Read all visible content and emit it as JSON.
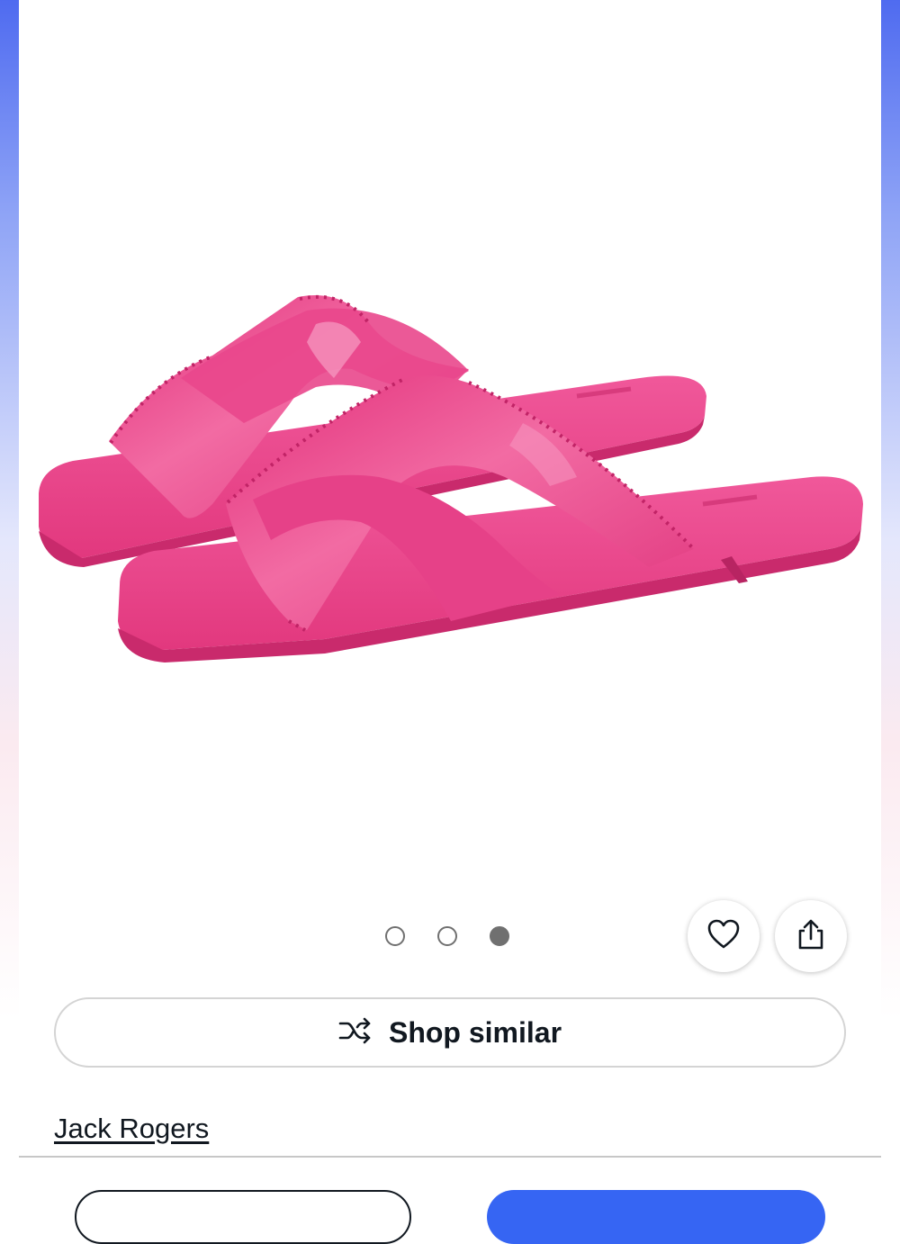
{
  "colors": {
    "accent": "#3665f3",
    "product_pink": "#ef3f8a",
    "text": "#111820",
    "dot": "#707070"
  },
  "gallery": {
    "image_alt": "Pink crisscross slide sandals",
    "image_count": 3,
    "active_index": 2
  },
  "actions": {
    "favorite_icon": "heart-icon",
    "share_icon": "share-icon"
  },
  "shop_similar": {
    "label": "Shop similar",
    "icon": "shuffle-icon"
  },
  "brand": {
    "name": "Jack Rogers"
  },
  "bottom_bar": {
    "secondary_label": "",
    "primary_label": ""
  }
}
